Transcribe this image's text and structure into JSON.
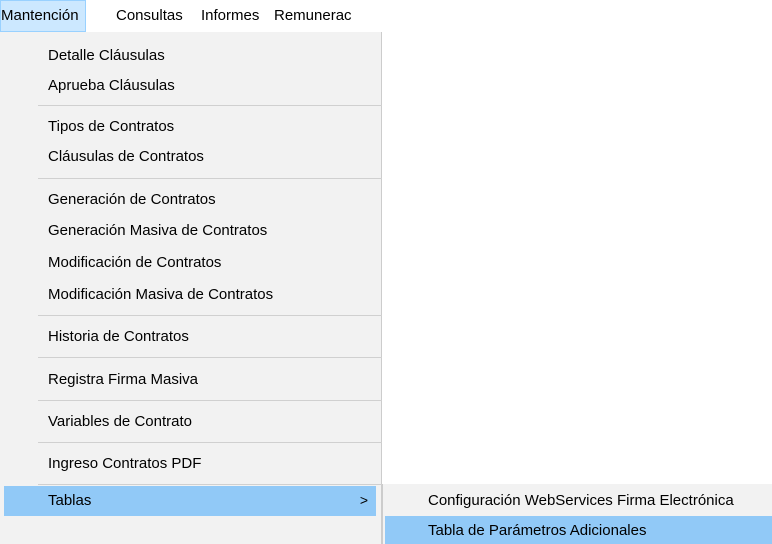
{
  "menubar": {
    "items": [
      {
        "label": "Mantención"
      },
      {
        "label": "Consultas"
      },
      {
        "label": "Informes"
      },
      {
        "label": "Remunerac"
      }
    ]
  },
  "dropdown": {
    "items": [
      {
        "label": "Detalle Cláusulas"
      },
      {
        "label": "Aprueba Cláusulas"
      },
      {
        "label": "Tipos de Contratos"
      },
      {
        "label": "Cláusulas de Contratos"
      },
      {
        "label": "Generación de Contratos"
      },
      {
        "label": "Generación Masiva de Contratos"
      },
      {
        "label": "Modificación de Contratos"
      },
      {
        "label": "Modificación Masiva de Contratos"
      },
      {
        "label": "Historia de Contratos"
      },
      {
        "label": "Registra Firma Masiva"
      },
      {
        "label": "Variables de Contrato"
      },
      {
        "label": "Ingreso Contratos PDF"
      },
      {
        "label": "Tablas",
        "arrow": ">"
      }
    ]
  },
  "submenu": {
    "items": [
      {
        "label": "Configuración WebServices Firma Electrónica"
      },
      {
        "label": "Tabla de Parámetros Adicionales"
      }
    ]
  },
  "colors": {
    "menu_background": "#f2f2f2",
    "highlight": "#91c9f7",
    "menubar_active": "#cce8ff",
    "separator": "#d0d0d0"
  }
}
